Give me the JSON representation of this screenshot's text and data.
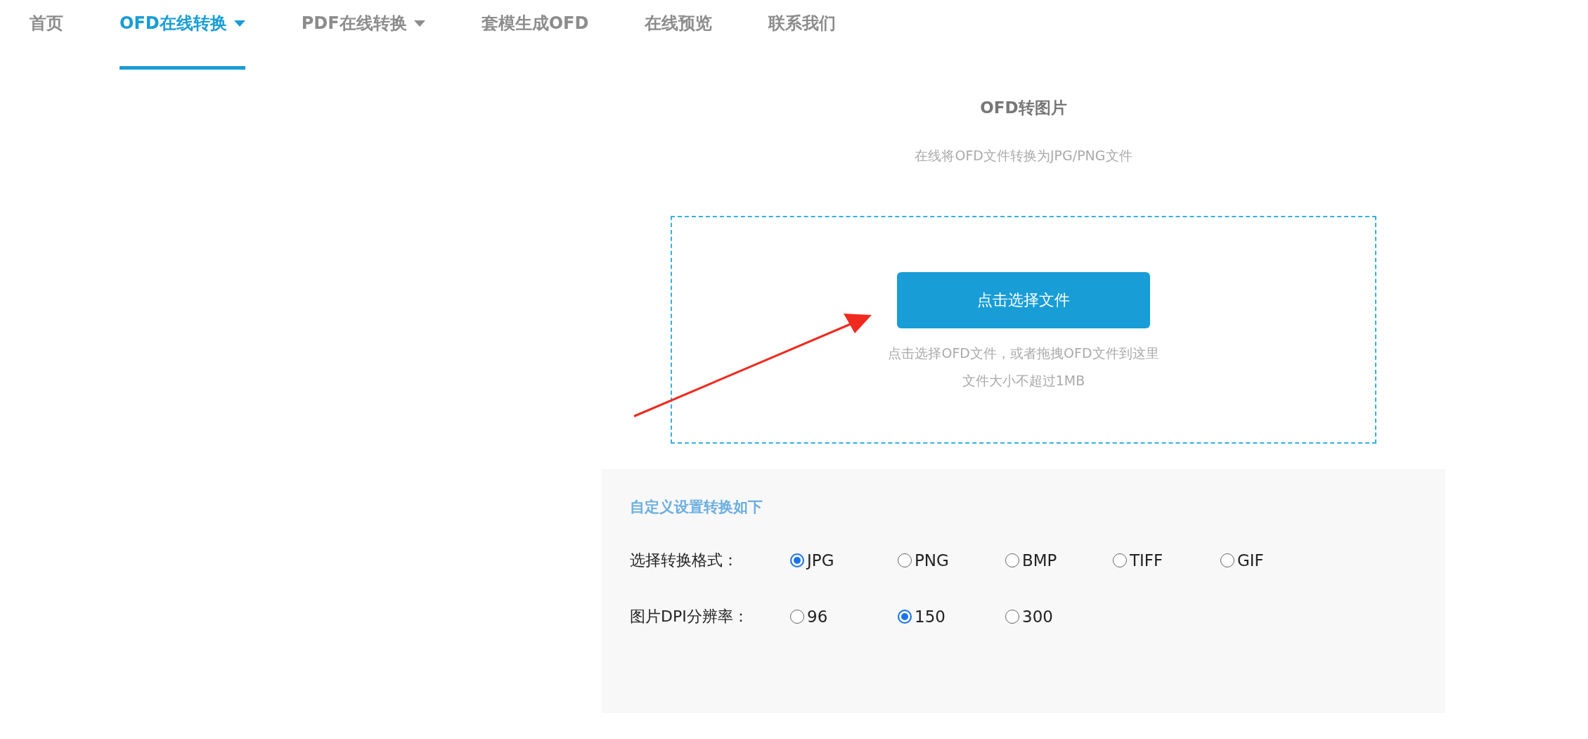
{
  "nav": [
    {
      "label": "首页",
      "selected": false,
      "dropdown": false
    },
    {
      "label": "OFD在线转换",
      "selected": true,
      "dropdown": true
    },
    {
      "label": "PDF在线转换",
      "selected": false,
      "dropdown": true
    },
    {
      "label": "套模生成OFD",
      "selected": false,
      "dropdown": false
    },
    {
      "label": "在线预览",
      "selected": false,
      "dropdown": false
    },
    {
      "label": "联系我们",
      "selected": false,
      "dropdown": false
    }
  ],
  "title": "OFD转图片",
  "subtitle": "在线将OFD文件转换为JPG/PNG文件",
  "upload": {
    "button": "点击选择文件",
    "hints": [
      "点击选择OFD文件，或者拖拽OFD文件到这里",
      "文件大小不超过1MB"
    ]
  },
  "settings": {
    "heading": "自定义设置转换如下",
    "groups": [
      {
        "label": "选择转换格式：",
        "options": [
          {
            "label": "JPG",
            "selected": true
          },
          {
            "label": "PNG",
            "selected": false
          },
          {
            "label": "BMP",
            "selected": false
          },
          {
            "label": "TIFF",
            "selected": false
          },
          {
            "label": "GIF",
            "selected": false
          }
        ]
      },
      {
        "label": "图片DPI分辨率：",
        "options": [
          {
            "label": "96",
            "selected": false
          },
          {
            "label": "150",
            "selected": true
          },
          {
            "label": "300",
            "selected": false
          }
        ]
      }
    ]
  }
}
